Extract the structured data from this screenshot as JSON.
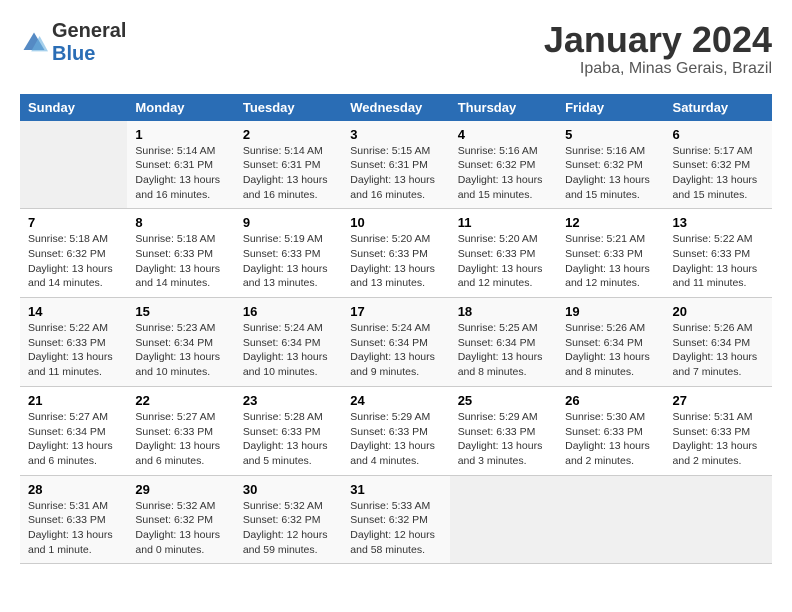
{
  "logo": {
    "text_general": "General",
    "text_blue": "Blue"
  },
  "title": "January 2024",
  "subtitle": "Ipaba, Minas Gerais, Brazil",
  "days_of_week": [
    "Sunday",
    "Monday",
    "Tuesday",
    "Wednesday",
    "Thursday",
    "Friday",
    "Saturday"
  ],
  "weeks": [
    [
      {
        "day": "",
        "info": ""
      },
      {
        "day": "1",
        "info": "Sunrise: 5:14 AM\nSunset: 6:31 PM\nDaylight: 13 hours\nand 16 minutes."
      },
      {
        "day": "2",
        "info": "Sunrise: 5:14 AM\nSunset: 6:31 PM\nDaylight: 13 hours\nand 16 minutes."
      },
      {
        "day": "3",
        "info": "Sunrise: 5:15 AM\nSunset: 6:31 PM\nDaylight: 13 hours\nand 16 minutes."
      },
      {
        "day": "4",
        "info": "Sunrise: 5:16 AM\nSunset: 6:32 PM\nDaylight: 13 hours\nand 15 minutes."
      },
      {
        "day": "5",
        "info": "Sunrise: 5:16 AM\nSunset: 6:32 PM\nDaylight: 13 hours\nand 15 minutes."
      },
      {
        "day": "6",
        "info": "Sunrise: 5:17 AM\nSunset: 6:32 PM\nDaylight: 13 hours\nand 15 minutes."
      }
    ],
    [
      {
        "day": "7",
        "info": "Sunrise: 5:18 AM\nSunset: 6:32 PM\nDaylight: 13 hours\nand 14 minutes."
      },
      {
        "day": "8",
        "info": "Sunrise: 5:18 AM\nSunset: 6:33 PM\nDaylight: 13 hours\nand 14 minutes."
      },
      {
        "day": "9",
        "info": "Sunrise: 5:19 AM\nSunset: 6:33 PM\nDaylight: 13 hours\nand 13 minutes."
      },
      {
        "day": "10",
        "info": "Sunrise: 5:20 AM\nSunset: 6:33 PM\nDaylight: 13 hours\nand 13 minutes."
      },
      {
        "day": "11",
        "info": "Sunrise: 5:20 AM\nSunset: 6:33 PM\nDaylight: 13 hours\nand 12 minutes."
      },
      {
        "day": "12",
        "info": "Sunrise: 5:21 AM\nSunset: 6:33 PM\nDaylight: 13 hours\nand 12 minutes."
      },
      {
        "day": "13",
        "info": "Sunrise: 5:22 AM\nSunset: 6:33 PM\nDaylight: 13 hours\nand 11 minutes."
      }
    ],
    [
      {
        "day": "14",
        "info": "Sunrise: 5:22 AM\nSunset: 6:33 PM\nDaylight: 13 hours\nand 11 minutes."
      },
      {
        "day": "15",
        "info": "Sunrise: 5:23 AM\nSunset: 6:34 PM\nDaylight: 13 hours\nand 10 minutes."
      },
      {
        "day": "16",
        "info": "Sunrise: 5:24 AM\nSunset: 6:34 PM\nDaylight: 13 hours\nand 10 minutes."
      },
      {
        "day": "17",
        "info": "Sunrise: 5:24 AM\nSunset: 6:34 PM\nDaylight: 13 hours\nand 9 minutes."
      },
      {
        "day": "18",
        "info": "Sunrise: 5:25 AM\nSunset: 6:34 PM\nDaylight: 13 hours\nand 8 minutes."
      },
      {
        "day": "19",
        "info": "Sunrise: 5:26 AM\nSunset: 6:34 PM\nDaylight: 13 hours\nand 8 minutes."
      },
      {
        "day": "20",
        "info": "Sunrise: 5:26 AM\nSunset: 6:34 PM\nDaylight: 13 hours\nand 7 minutes."
      }
    ],
    [
      {
        "day": "21",
        "info": "Sunrise: 5:27 AM\nSunset: 6:34 PM\nDaylight: 13 hours\nand 6 minutes."
      },
      {
        "day": "22",
        "info": "Sunrise: 5:27 AM\nSunset: 6:33 PM\nDaylight: 13 hours\nand 6 minutes."
      },
      {
        "day": "23",
        "info": "Sunrise: 5:28 AM\nSunset: 6:33 PM\nDaylight: 13 hours\nand 5 minutes."
      },
      {
        "day": "24",
        "info": "Sunrise: 5:29 AM\nSunset: 6:33 PM\nDaylight: 13 hours\nand 4 minutes."
      },
      {
        "day": "25",
        "info": "Sunrise: 5:29 AM\nSunset: 6:33 PM\nDaylight: 13 hours\nand 3 minutes."
      },
      {
        "day": "26",
        "info": "Sunrise: 5:30 AM\nSunset: 6:33 PM\nDaylight: 13 hours\nand 2 minutes."
      },
      {
        "day": "27",
        "info": "Sunrise: 5:31 AM\nSunset: 6:33 PM\nDaylight: 13 hours\nand 2 minutes."
      }
    ],
    [
      {
        "day": "28",
        "info": "Sunrise: 5:31 AM\nSunset: 6:33 PM\nDaylight: 13 hours\nand 1 minute."
      },
      {
        "day": "29",
        "info": "Sunrise: 5:32 AM\nSunset: 6:32 PM\nDaylight: 13 hours\nand 0 minutes."
      },
      {
        "day": "30",
        "info": "Sunrise: 5:32 AM\nSunset: 6:32 PM\nDaylight: 12 hours\nand 59 minutes."
      },
      {
        "day": "31",
        "info": "Sunrise: 5:33 AM\nSunset: 6:32 PM\nDaylight: 12 hours\nand 58 minutes."
      },
      {
        "day": "",
        "info": ""
      },
      {
        "day": "",
        "info": ""
      },
      {
        "day": "",
        "info": ""
      }
    ]
  ]
}
